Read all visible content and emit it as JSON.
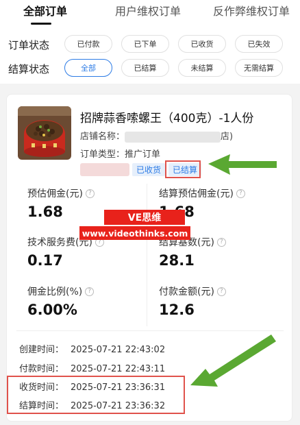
{
  "tabs": [
    {
      "label": "全部订单",
      "active": true
    },
    {
      "label": "用户维权订单",
      "active": false
    },
    {
      "label": "反作弊维权订单",
      "active": false
    }
  ],
  "filters": {
    "order_status": {
      "label": "订单状态",
      "options": [
        "已付款",
        "已下单",
        "已收货",
        "已失效"
      ]
    },
    "settle_status": {
      "label": "结算状态",
      "options": [
        "全部",
        "已结算",
        "未结算",
        "无需结算"
      ],
      "selected": "全部"
    }
  },
  "order": {
    "title": "招牌蒜香嗦螺王（400克）-1人份",
    "store_label": "店铺名称：",
    "store_suffix": "店)",
    "type_label": "订单类型：",
    "type_value": "推广订单",
    "tags": [
      "已收货",
      "已结算"
    ],
    "metrics": [
      {
        "label": "预估佣金(元)",
        "value": "1.68"
      },
      {
        "label": "结算预估佣金(元)",
        "value": "1.68"
      },
      {
        "label": "技术服务费(元)",
        "value": "0.17"
      },
      {
        "label": "结算基数(元)",
        "value": "28.1"
      },
      {
        "label": "佣金比例(%)",
        "value": "6.00%"
      },
      {
        "label": "付款金额(元)",
        "value": "12.6"
      }
    ],
    "times": [
      {
        "label": "创建时间：",
        "value": "2025-07-21 22:43:02"
      },
      {
        "label": "付款时间：",
        "value": "2025-07-21 22:43:11"
      },
      {
        "label": "收货时间：",
        "value": "2025-07-21 23:36:31"
      },
      {
        "label": "结算时间：",
        "value": "2025-07-21 23:36:32"
      }
    ]
  },
  "watermark": {
    "brand": "VE思维",
    "url": "www.videothinks.com"
  },
  "colors": {
    "accent": "#2c7be5",
    "highlight": "#e0524b",
    "arrow": "#5aa832",
    "watermark": "#e8221b"
  }
}
